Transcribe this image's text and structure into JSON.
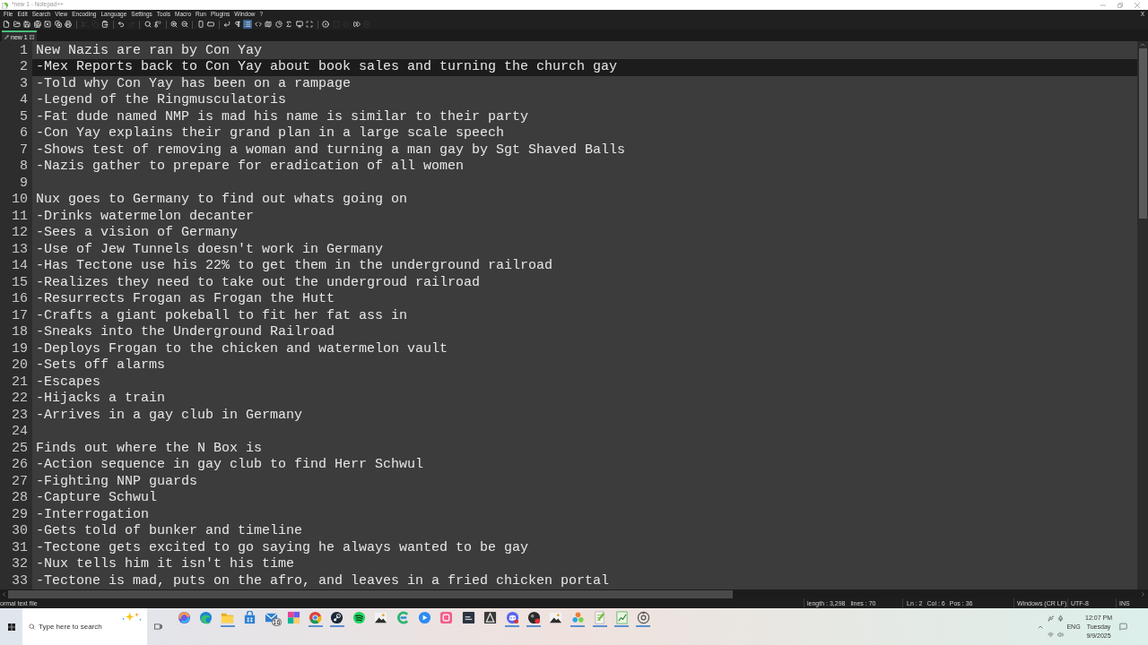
{
  "window": {
    "title": "*new 1 - Notepad++"
  },
  "menu": [
    "File",
    "Edit",
    "Search",
    "View",
    "Encoding",
    "Language",
    "Settings",
    "Tools",
    "Macro",
    "Run",
    "Plugins",
    "Window",
    "?"
  ],
  "menu_close": "X",
  "toolbar": {
    "groups": [
      {
        "buttons": [
          {
            "disabled": false,
            "on": false
          },
          {
            "disabled": false,
            "on": false
          },
          {
            "disabled": false,
            "on": false
          },
          {
            "disabled": false,
            "on": false
          },
          {
            "disabled": false,
            "on": false
          },
          {
            "disabled": false,
            "on": false
          },
          {
            "disabled": false,
            "on": false
          }
        ]
      },
      {
        "buttons": [
          {
            "disabled": true,
            "on": false
          },
          {
            "disabled": true,
            "on": false
          },
          {
            "disabled": false,
            "on": false
          }
        ]
      },
      {
        "buttons": [
          {
            "disabled": false,
            "on": false
          },
          {
            "disabled": true,
            "on": false
          }
        ]
      },
      {
        "buttons": [
          {
            "disabled": false,
            "on": false
          },
          {
            "disabled": false,
            "on": false
          }
        ]
      },
      {
        "buttons": [
          {
            "disabled": false,
            "on": false
          },
          {
            "disabled": false,
            "on": false
          }
        ]
      },
      {
        "buttons": [
          {
            "disabled": false,
            "on": false
          },
          {
            "disabled": false,
            "on": false
          }
        ]
      },
      {
        "buttons": [
          {
            "disabled": false,
            "on": false
          },
          {
            "disabled": false,
            "on": false
          },
          {
            "disabled": false,
            "on": true
          },
          {
            "disabled": false,
            "on": false
          },
          {
            "disabled": false,
            "on": false
          },
          {
            "disabled": false,
            "on": false
          },
          {
            "disabled": false,
            "on": false
          },
          {
            "disabled": false,
            "on": false
          },
          {
            "disabled": false,
            "on": false
          }
        ]
      },
      {
        "buttons": [
          {
            "disabled": false,
            "on": false
          },
          {
            "disabled": true,
            "on": false
          },
          {
            "disabled": true,
            "on": false
          },
          {
            "disabled": false,
            "on": false
          },
          {
            "disabled": true,
            "on": false
          }
        ]
      }
    ]
  },
  "tabs": [
    {
      "label": "new 1",
      "selected": true,
      "modified": true
    }
  ],
  "editor": {
    "lines": [
      {
        "number": "1",
        "text": "New Nazis are ran by Con Yay",
        "current": false
      },
      {
        "number": "2",
        "text": "-Mex Reports back to Con Yay about book sales and turning the church gay",
        "current": true
      },
      {
        "number": "3",
        "text": "-Told why Con Yay has been on a rampage",
        "current": false
      },
      {
        "number": "4",
        "text": "-Legend of the Ringmusculatoris",
        "current": false
      },
      {
        "number": "5",
        "text": "-Fat dude named NMP is mad his name is similar to their party",
        "current": false
      },
      {
        "number": "6",
        "text": "-Con Yay explains their grand plan in a large scale speech",
        "current": false
      },
      {
        "number": "7",
        "text": "-Shows test of removing a woman and turning a man gay by Sgt Shaved Balls",
        "current": false
      },
      {
        "number": "8",
        "text": "-Nazis gather to prepare for eradication of all women",
        "current": false
      },
      {
        "number": "9",
        "current": false
      },
      {
        "number": "10",
        "text": "Nux goes to Germany to find out whats going on",
        "current": false
      },
      {
        "number": "11",
        "text": "-Drinks watermelon decanter",
        "current": false
      },
      {
        "number": "12",
        "text": "-Sees a vision of Germany",
        "current": false
      },
      {
        "number": "13",
        "text": "-Use of Jew Tunnels doesn't work in Germany",
        "current": false
      },
      {
        "number": "14",
        "text": "-Has Tectone use his 22% to get them in the underground railroad",
        "current": false
      },
      {
        "number": "15",
        "text": "-Realizes they need to take out the undergroud railroad",
        "current": false
      },
      {
        "number": "16",
        "text": "-Resurrects Frogan as Frogan the Hutt",
        "current": false
      },
      {
        "number": "17",
        "text": "-Crafts a giant pokeball to fit her fat ass in",
        "current": false
      },
      {
        "number": "18",
        "text": "-Sneaks into the Underground Railroad",
        "current": false
      },
      {
        "number": "19",
        "text": "-Deploys Frogan to the chicken and watermelon vault",
        "current": false
      },
      {
        "number": "20",
        "text": "-Sets off alarms",
        "current": false
      },
      {
        "number": "21",
        "text": "-Escapes",
        "current": false
      },
      {
        "number": "22",
        "text": "-Hijacks a train",
        "current": false
      },
      {
        "number": "23",
        "text": "-Arrives in a gay club in Germany",
        "current": false
      },
      {
        "number": "24",
        "current": false
      },
      {
        "number": "25",
        "text": "Finds out where the N Box is",
        "current": false
      },
      {
        "number": "26",
        "text": "-Action sequence in gay club to find Herr Schwul",
        "current": false
      },
      {
        "number": "27",
        "text": "-Fighting NNP guards",
        "current": false
      },
      {
        "number": "28",
        "text": "-Capture Schwul",
        "current": false
      },
      {
        "number": "29",
        "text": "-Interrogation",
        "current": false
      },
      {
        "number": "30",
        "text": "-Gets told of bunker and timeline",
        "current": false
      },
      {
        "number": "31",
        "text": "-Tectone gets excited to go saying he always wanted to be gay",
        "current": false
      },
      {
        "number": "32",
        "text": "-Nux tells him it isn't his time",
        "current": false
      },
      {
        "number": "33",
        "text": "-Tectone is mad, puts on the afro, and leaves in a fried chicken portal",
        "current": false
      }
    ]
  },
  "status_bar": {
    "file_type": "ormal text file",
    "length": "length : 3,298",
    "lines": "lines : 70",
    "ln": "Ln : 2",
    "col": "Col : 6",
    "pos": "Pos : 36",
    "eol": "Windows (CR LF)",
    "encoding": "UTF-8",
    "mode": "INS"
  },
  "taskbar": {
    "search": {
      "placeholder": "Type here to search"
    },
    "apps": [
      {
        "running": false
      },
      {
        "running": false
      },
      {
        "running": true
      },
      {
        "running": false
      },
      {
        "running": false,
        "badge": "16"
      },
      {
        "running": false
      },
      {
        "running": true
      },
      {
        "running": true
      },
      {
        "running": false
      },
      {
        "running": false
      },
      {
        "running": false
      },
      {
        "running": false
      },
      {
        "running": false
      },
      {
        "running": false
      },
      {
        "running": false
      },
      {
        "running": true
      },
      {
        "running": true
      },
      {
        "running": false
      },
      {
        "running": true
      },
      {
        "running": true
      },
      {
        "running": true
      },
      {
        "running": true
      }
    ],
    "tray": {
      "language": "ENG",
      "time": "12:07 PM",
      "day": "Tuesday",
      "date": "9/9/2025"
    }
  }
}
